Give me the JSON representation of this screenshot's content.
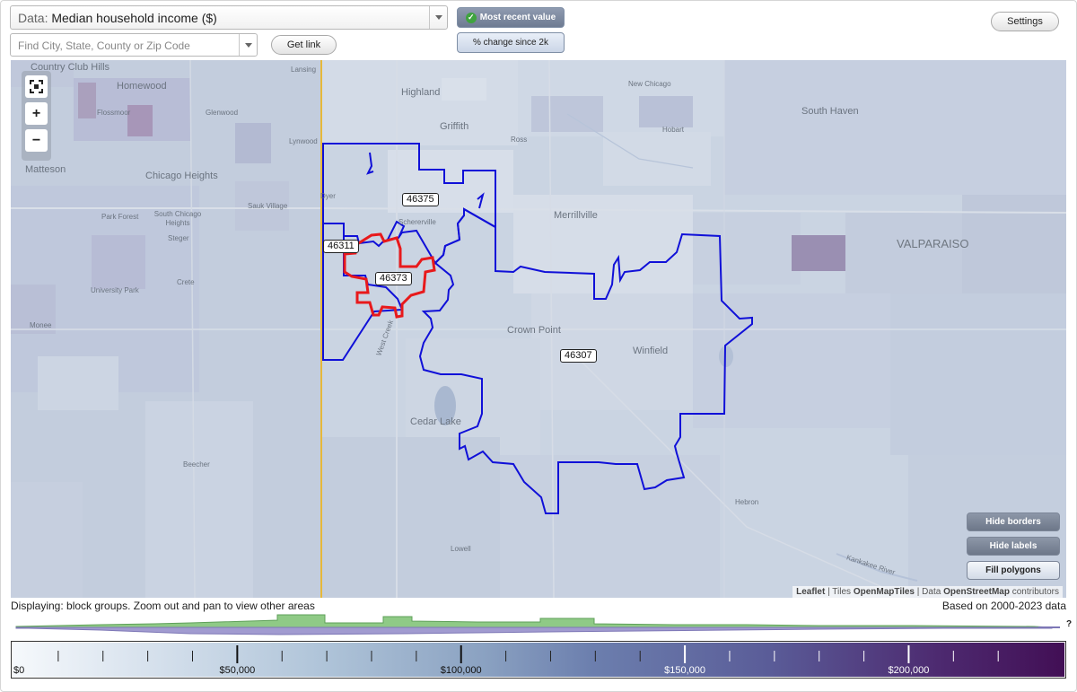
{
  "controls": {
    "data_prefix": "Data:",
    "data_value": "Median household income ($)",
    "search_placeholder": "Find City, State, County or Zip Code",
    "get_link": "Get link",
    "most_recent": "Most recent value",
    "pct_change": "% change since 2k",
    "settings": "Settings"
  },
  "map": {
    "places": {
      "country_club_hills": "Country Club Hills",
      "homewood": "Homewood",
      "flossmoor": "Flossmoor",
      "glenwood": "Glenwood",
      "lansing": "Lansing",
      "lynwood": "Lynwood",
      "highland": "Highland",
      "griffith": "Griffith",
      "ross": "Ross",
      "new_chicago": "New Chicago",
      "hobart": "Hobart",
      "south_haven": "South Haven",
      "matteson": "Matteson",
      "chicago_heights": "Chicago Heights",
      "dyer": "Dyer",
      "schererville": "Schererville",
      "sauk_village": "Sauk Village",
      "park_forest": "Park Forest",
      "south_chicago_heights": "South Chicago Heights",
      "steger": "Steger",
      "merrillville": "Merrillville",
      "valparaiso": "VALPARAISO",
      "crete": "Crete",
      "university_park": "University Park",
      "monee": "Monee",
      "crown_point": "Crown Point",
      "winfield": "Winfield",
      "west_creek": "West Creek",
      "cedar_lake": "Cedar Lake",
      "beecher": "Beecher",
      "lowell": "Lowell",
      "hebron": "Hebron",
      "kankakee_river": "Kankakee River"
    },
    "zip_labels": [
      "46375",
      "46311",
      "46373",
      "46307"
    ],
    "highlight_color": "#e8191b",
    "border_color": "#1010d8",
    "state_line_color": "#e6b83a",
    "buttons": {
      "hide_borders": "Hide borders",
      "hide_labels": "Hide labels",
      "fill_polygons": "Fill polygons"
    },
    "attribution": {
      "leaflet": "Leaflet",
      "sep1": " | Tiles ",
      "tiles": "OpenMapTiles",
      "sep2": " | Data ",
      "data": "OpenStreetMap",
      "contributors": " contributors"
    }
  },
  "status": {
    "displaying": "Displaying: block groups. Zoom out and pan to view other areas",
    "based_on": "Based on 2000-2023 data",
    "question": "?"
  },
  "legend": {
    "labels": [
      "$0",
      "$50,000",
      "$100,000",
      "$150,000",
      "$200,000"
    ],
    "min": 0,
    "max": 235000,
    "major_ticks": [
      50000,
      100000,
      150000,
      200000
    ],
    "minor_ticks": [
      10000,
      20000,
      30000,
      40000,
      60000,
      70000,
      80000,
      90000,
      110000,
      120000,
      130000,
      140000,
      160000,
      170000,
      180000,
      190000,
      210000,
      220000
    ]
  }
}
